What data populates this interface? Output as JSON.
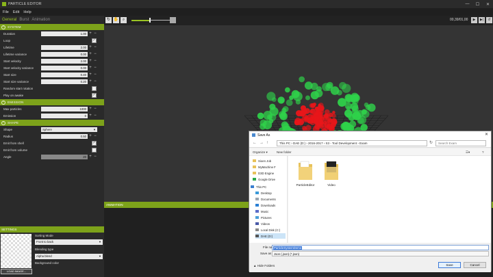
{
  "window": {
    "title": "PARTICLE EDITOR",
    "min": "—",
    "max": "☐",
    "close": "✕"
  },
  "menu": [
    "File",
    "Edit",
    "Help"
  ],
  "tabs": [
    "General",
    "Burst",
    "Animation"
  ],
  "system": {
    "header": "SYSTEM",
    "props": [
      {
        "label": "Duration",
        "value": "1.00"
      },
      {
        "label": "Loop",
        "checked": "✓"
      },
      {
        "label": "Lifetime",
        "value": "2.00"
      },
      {
        "label": "Lifetime variance",
        "value": "0.00"
      },
      {
        "label": "Start velocity",
        "value": "2.00"
      },
      {
        "label": "Start velocity variance",
        "value": "0.00"
      },
      {
        "label": "Start size",
        "value": "0.40"
      },
      {
        "label": "Start size variance",
        "value": "0.20"
      },
      {
        "label": "Random start rotation",
        "checked": ""
      },
      {
        "label": "Play on awake",
        "checked": "✓"
      }
    ]
  },
  "emission": {
    "header": "EMISSION",
    "props": [
      {
        "label": "Max particles",
        "value": "1000"
      },
      {
        "label": "Emission",
        "value": "0"
      }
    ]
  },
  "shape": {
    "header": "SHAPE",
    "shape_label": "Shape",
    "shape_value": "Sphere",
    "radius_label": "Radius",
    "radius_value": "0.50",
    "emit_shell_label": "Emit from shell",
    "emit_shell_checked": "✓",
    "emit_volume_label": "Emit from volume",
    "emit_volume_checked": "",
    "angle_label": "Angle",
    "angle_value": "20"
  },
  "settings": {
    "header": "SETTINGS",
    "sorting_label": "Sorting Mode",
    "sorting_value": "Front to back",
    "blending_label": "Blending type",
    "blending_value": "Alpha blend",
    "bg_label": "Background color",
    "load_button": "LOAD IMAGE..."
  },
  "viewport": {
    "timecode": "00,39/01,00",
    "zoom_fill": 0.5,
    "tool_icons": [
      "rotate-icon",
      "pan-icon",
      "zoom-icon"
    ],
    "playback_icons": [
      "play-icon",
      "step-icon",
      "loop-icon"
    ]
  },
  "animation": {
    "header": "ANIMATION"
  },
  "dialog": {
    "title": "Save As",
    "close": "✕",
    "address": "This PC  ›  DAE (D:)  ›  2016-2017  ›  S3 - Tool Development  ›  Exam",
    "search_placeholder": "Search Exam",
    "organize": "Organize ▾",
    "new_folder": "New folder",
    "nav_items": [
      {
        "label": "Sioen Job",
        "icon": "folder-icon"
      },
      {
        "label": "MyMachine F",
        "icon": "folder-icon"
      },
      {
        "label": "D3D Engine",
        "icon": "folder-icon"
      },
      {
        "label": "Google Drive",
        "icon": "drive-icon"
      },
      {
        "label": "This PC",
        "icon": "pc-icon"
      },
      {
        "label": "Desktop",
        "icon": "desktop-icon"
      },
      {
        "label": "Documents",
        "icon": "documents-icon"
      },
      {
        "label": "Downloads",
        "icon": "downloads-icon"
      },
      {
        "label": "Music",
        "icon": "music-icon"
      },
      {
        "label": "Pictures",
        "icon": "pictures-icon"
      },
      {
        "label": "Videos",
        "icon": "videos-icon"
      },
      {
        "label": "Local Disk (C:)",
        "icon": "disk-icon"
      },
      {
        "label": "DAE (D:)",
        "icon": "disk-icon"
      }
    ],
    "folders": [
      {
        "label": "ParticleEditor"
      },
      {
        "label": "Video"
      }
    ],
    "filename_label": "File name:",
    "filename_value": "ParticleSystemDemo",
    "savetype_label": "Save as type:",
    "savetype_value": "Json (.json)  (*.json)",
    "hide_folders": "▲  Hide Folders",
    "save_button": "Save",
    "cancel_button": "Cancel"
  }
}
